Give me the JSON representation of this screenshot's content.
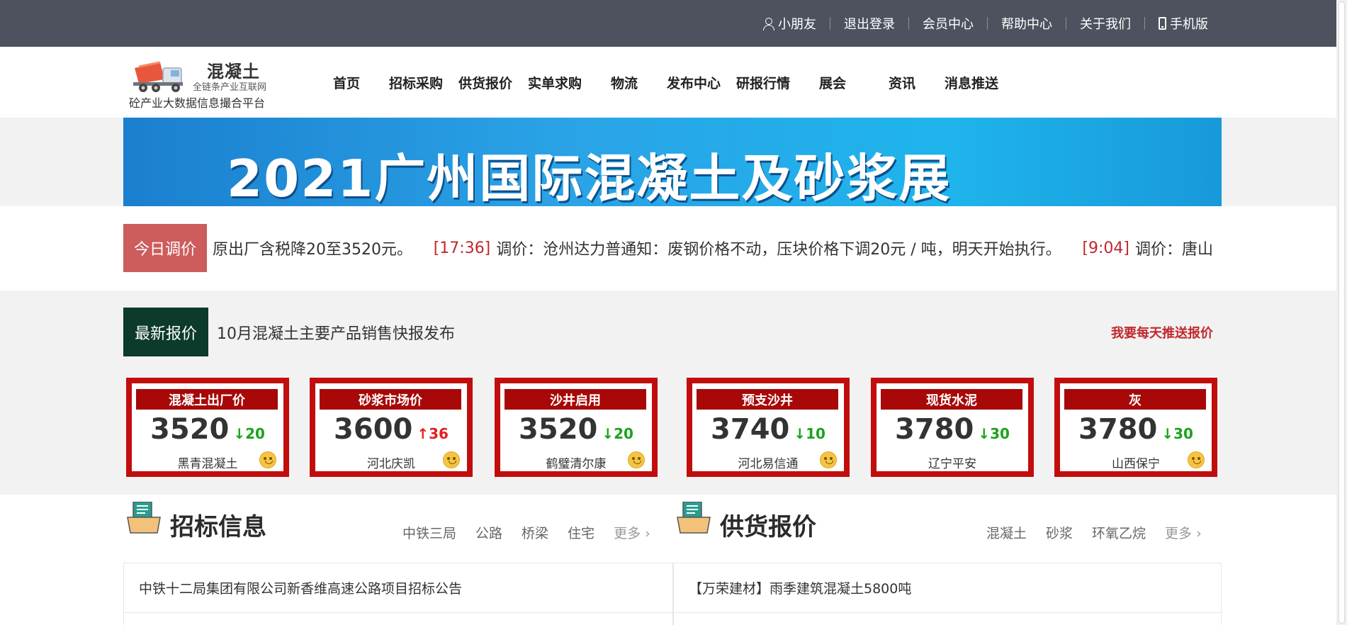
{
  "topbar": {
    "user": "小朋友",
    "logout": "退出登录",
    "member": "会员中心",
    "help": "帮助中心",
    "about": "关于我们",
    "mobile": "手机版"
  },
  "logo": {
    "brand": "混凝土",
    "sub": "全链条产业互联网",
    "slogan": "砼产业大数据信息撮合平台"
  },
  "nav": [
    "首页",
    "招标采购",
    "供货报价",
    "实单求购",
    "物流",
    "发布中心",
    "研报行情",
    "展会",
    "资讯",
    "消息推送"
  ],
  "banner": {
    "text": "2021广州国际混凝土及砂浆展"
  },
  "ticker": {
    "tag": "今日调价",
    "items": [
      {
        "time": "",
        "text": "原出厂含税降20至3520元。"
      },
      {
        "time": "[17:36]",
        "text": "调价：沧州达力普通知：废钢价格不动，压块价格下调20元 / 吨，明天开始执行。"
      },
      {
        "time": "[9:04]",
        "text": "调价：唐山"
      }
    ]
  },
  "quotes": {
    "tag": "最新报价",
    "title": "10月混凝土主要产品销售快报发布",
    "push": "我要每天推送报价",
    "cards": [
      {
        "label": "混凝土出厂价",
        "price": "3520",
        "change": "20",
        "dir": "down",
        "company": "黑青混凝土"
      },
      {
        "label": "砂浆市场价",
        "price": "3600",
        "change": "36",
        "dir": "up",
        "company": "河北庆凯"
      },
      {
        "label": "沙井启用",
        "price": "3520",
        "change": "20",
        "dir": "down",
        "company": "鹤璧清尔康"
      },
      {
        "label": "预支沙井",
        "price": "3740",
        "change": "10",
        "dir": "down",
        "company": "河北易信通"
      },
      {
        "label": "现货水泥",
        "price": "3780",
        "change": "30",
        "dir": "down",
        "company": "辽宁平安"
      },
      {
        "label": "灰",
        "price": "3780",
        "change": "30",
        "dir": "down",
        "company": "山西保宁"
      }
    ]
  },
  "bidding": {
    "title": "招标信息",
    "tabs": [
      "中铁三局",
      "公路",
      "桥梁",
      "住宅"
    ],
    "more": "更多",
    "rows": [
      "中铁十二局集团有限公司新香维高速公路项目招标公告"
    ]
  },
  "supply": {
    "title": "供货报价",
    "tabs": [
      "混凝土",
      "砂浆",
      "环氧乙烷"
    ],
    "more": "更多",
    "rows": [
      "【万荣建材】雨季建筑混凝土5800吨"
    ]
  },
  "colors": {
    "topbar": "#4d525e",
    "ticker_tag": "#cd5c5c",
    "quote_tag": "#0c3a2b",
    "card_border": "#c20d0d",
    "up": "#e02020",
    "down": "#1aa31a",
    "link_red": "#c0282d"
  }
}
